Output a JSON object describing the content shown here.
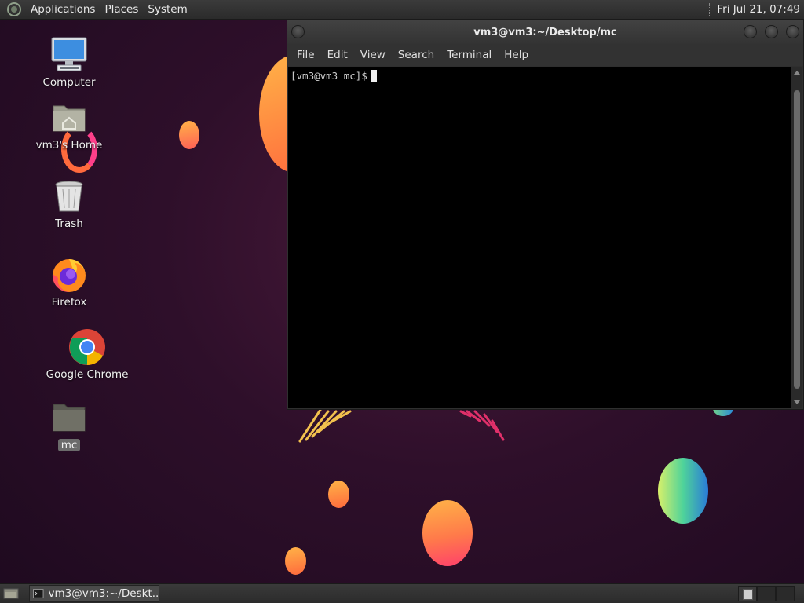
{
  "top_panel": {
    "menus": [
      "Applications",
      "Places",
      "System"
    ],
    "clock": "Fri Jul 21, 07:49"
  },
  "desktop": {
    "icons": [
      {
        "label": "Computer",
        "icon": "computer-icon"
      },
      {
        "label": "vm3's Home",
        "icon": "home-folder-icon"
      },
      {
        "label": "Trash",
        "icon": "trash-icon"
      },
      {
        "label": "Firefox",
        "icon": "firefox-icon"
      },
      {
        "label": "Google Chrome",
        "icon": "chrome-icon"
      },
      {
        "label": "mc",
        "icon": "folder-icon"
      }
    ]
  },
  "terminal": {
    "title": "vm3@vm3:~/Desktop/mc",
    "menus": [
      "File",
      "Edit",
      "View",
      "Search",
      "Terminal",
      "Help"
    ],
    "prompt": "[vm3@vm3 mc]$"
  },
  "bottom_panel": {
    "task_label": "vm3@vm3:~/Deskt..."
  },
  "colors": {
    "panel": "#2f2f2f",
    "terminal_bg": "#000000",
    "wallpaper": "#2e0f2a"
  }
}
